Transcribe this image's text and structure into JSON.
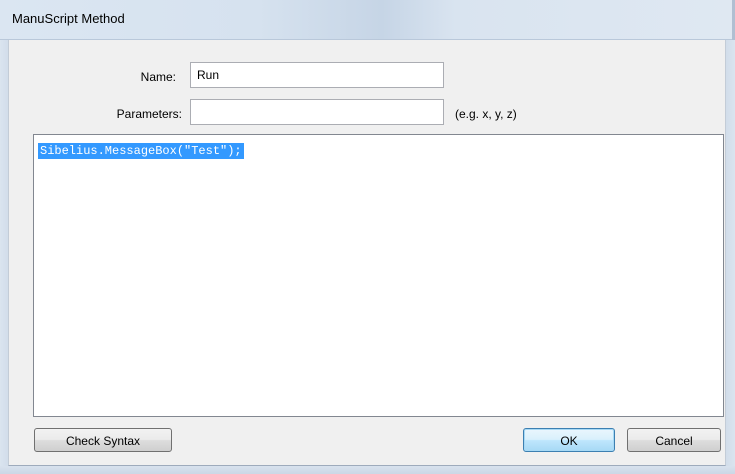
{
  "window": {
    "title": "ManuScript Method"
  },
  "form": {
    "name_label": "Name:",
    "name_value": "Run",
    "params_label": "Parameters:",
    "params_value": "",
    "params_hint": "(e.g. x, y, z)"
  },
  "editor": {
    "code": "Sibelius.MessageBox(\"Test\");",
    "selection_color": "#3399ff"
  },
  "buttons": {
    "check_syntax": "Check Syntax",
    "ok": "OK",
    "cancel": "Cancel"
  }
}
